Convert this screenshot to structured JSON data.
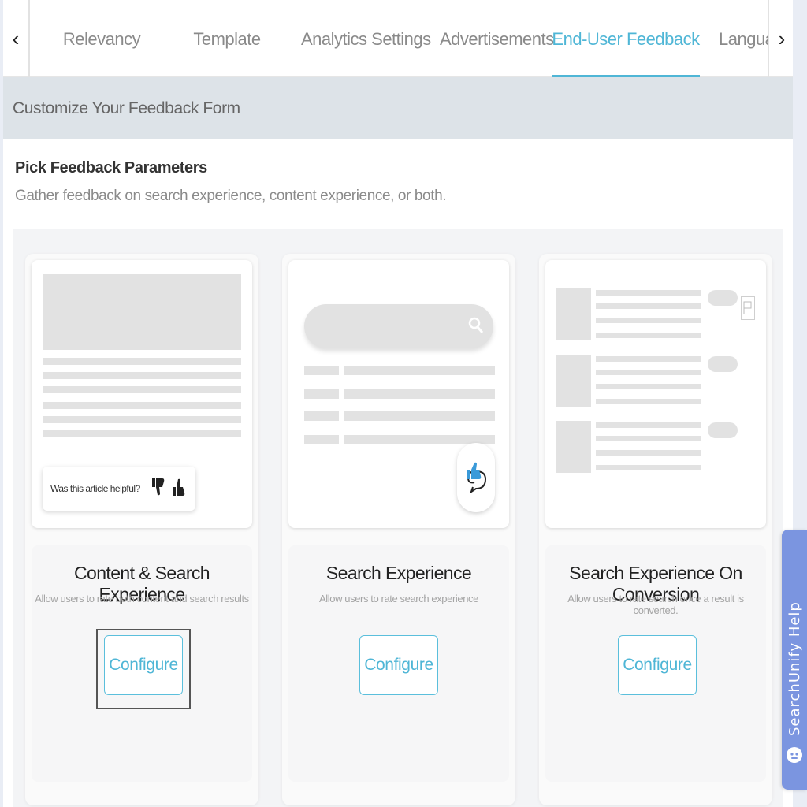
{
  "tabs": {
    "prev_glyph": "‹",
    "next_glyph": "›",
    "items": [
      {
        "label": "Relevancy"
      },
      {
        "label": "Template"
      },
      {
        "label": "Analytics Settings"
      },
      {
        "label": "Advertisements"
      },
      {
        "label": "End-User Feedback",
        "active": true
      },
      {
        "label": "Languag"
      }
    ],
    "accent_color": "#4fb6d6"
  },
  "section": {
    "header": "Customize Your Feedback Form",
    "params_title": "Pick Feedback Parameters",
    "params_subtitle": "Gather feedback on search experience, content experience, or both."
  },
  "cards": [
    {
      "title": "Content & Search Experience",
      "description": "Allow users to rate both content and search results",
      "button": "Configure",
      "preview_text": "Was this article helpful?",
      "focused": true
    },
    {
      "title": "Search Experience",
      "description": "Allow users to rate search experience",
      "button": "Configure"
    },
    {
      "title": "Search Experience On Conversion",
      "description": "Allow users to rate search once a result is converted.",
      "button": "Configure"
    }
  ],
  "help_widget": {
    "label": "SearchUnify Help",
    "color": "#7b95e0"
  }
}
